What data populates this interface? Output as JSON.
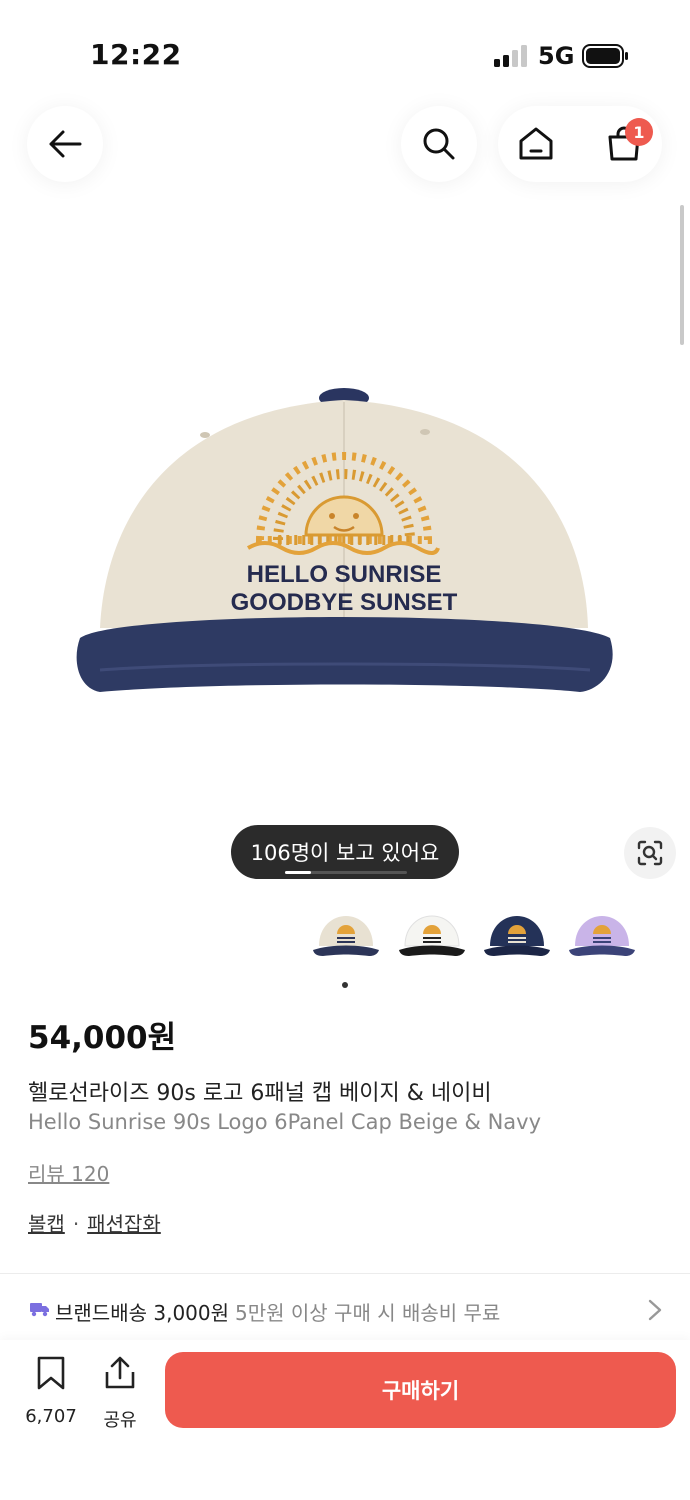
{
  "status_bar": {
    "time": "12:22",
    "network": "5G"
  },
  "nav": {
    "back_icon": "arrow-left-icon",
    "search_icon": "search-icon",
    "home_icon": "home-icon",
    "cart_icon": "shopping-bag-icon",
    "cart_count": "1"
  },
  "product_image": {
    "text_line1": "HELLO SUNRISE",
    "text_line2": "GOODBYE SUNSET",
    "colors": {
      "crown": "#e9e2d3",
      "brim": "#2e3a63",
      "sun": "#e3a23a"
    }
  },
  "viewers": "106명이 보고 있어요",
  "lens_icon": "image-search-icon",
  "thumbnails": [
    {
      "name": "beige-navy",
      "crown": "#e8e1d2",
      "brim": "#2c3558"
    },
    {
      "name": "white-black",
      "crown": "#f5f5f2",
      "brim": "#1a1a1a"
    },
    {
      "name": "navy",
      "crown": "#243258",
      "brim": "#1c2646"
    },
    {
      "name": "lavender",
      "crown": "#c9b4e8",
      "brim": "#3b4378"
    }
  ],
  "product": {
    "price": "54,000원",
    "title_ko": "헬로선라이즈 90s 로고 6패널 캡 베이지 & 네이비",
    "title_en": "Hello Sunrise 90s Logo 6Panel Cap Beige & Navy",
    "review": "리뷰 120",
    "brand": "볼캡",
    "category": "패션잡화",
    "separator": "·"
  },
  "shipping": {
    "label": "브랜드배송 3,000원",
    "note": "5만원 이상 구매 시 배송비 무료",
    "icon": "truck-icon",
    "icon_color": "#7b6fe0"
  },
  "bottom_bar": {
    "bookmark_count": "6,707",
    "share_label": "공유",
    "buy_label": "구매하기",
    "accent": "#ee5a4f"
  }
}
